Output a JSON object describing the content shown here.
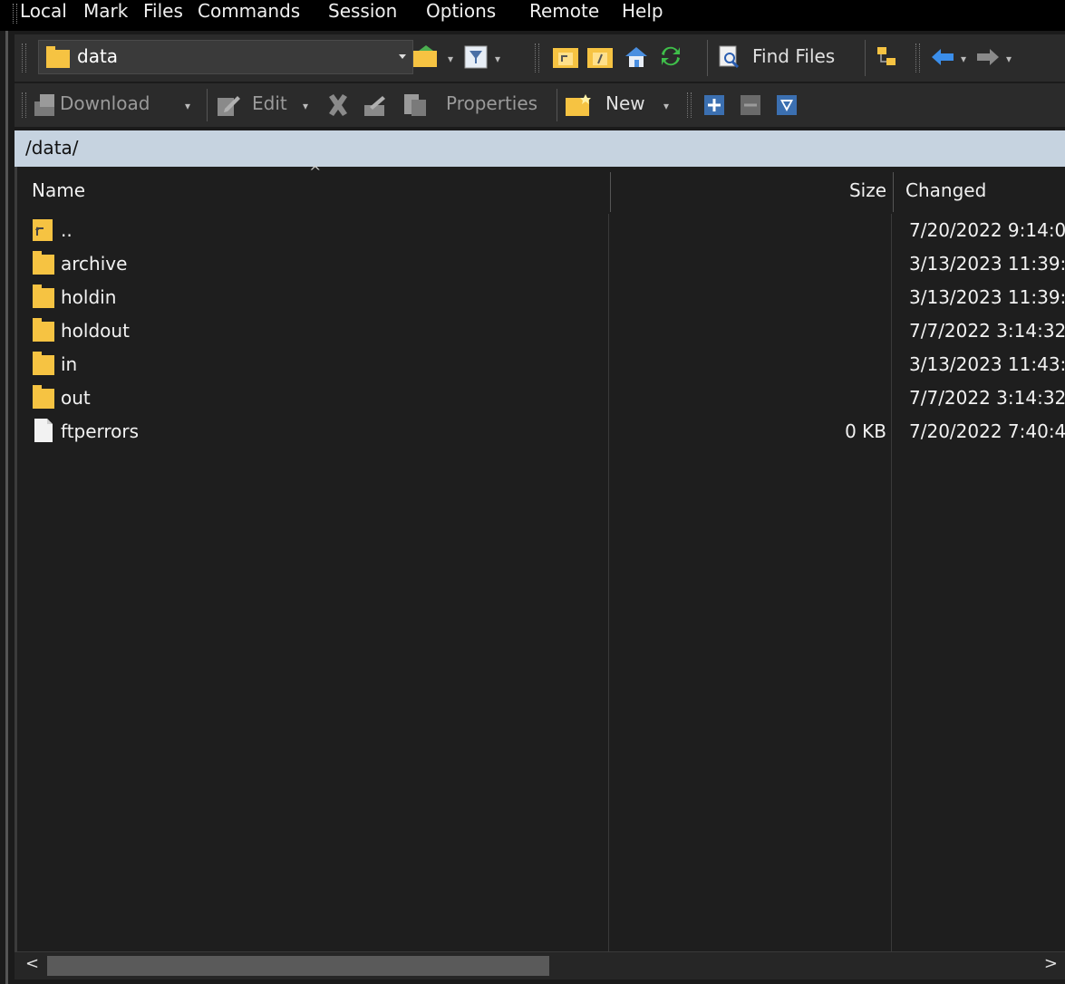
{
  "menu": [
    "Local",
    "Mark",
    "Files",
    "Commands",
    "Session",
    "Options",
    "Remote",
    "Help"
  ],
  "address": {
    "current": "data"
  },
  "toolbar1": {
    "find_files_label": "Find Files"
  },
  "toolbar2": {
    "download_label": "Download",
    "edit_label": "Edit",
    "properties_label": "Properties",
    "new_label": "New"
  },
  "path": "/data/",
  "columns": {
    "name": "Name",
    "size": "Size",
    "changed": "Changed"
  },
  "files": [
    {
      "name": "..",
      "size": "",
      "changed": "7/20/2022 9:14:0",
      "type": "parent"
    },
    {
      "name": "archive",
      "size": "",
      "changed": "3/13/2023 11:39:",
      "type": "folder"
    },
    {
      "name": "holdin",
      "size": "",
      "changed": "3/13/2023 11:39:",
      "type": "folder"
    },
    {
      "name": "holdout",
      "size": "",
      "changed": "7/7/2022 3:14:32",
      "type": "folder"
    },
    {
      "name": "in",
      "size": "",
      "changed": "3/13/2023 11:43:",
      "type": "folder"
    },
    {
      "name": "out",
      "size": "",
      "changed": "7/7/2022 3:14:32",
      "type": "folder"
    },
    {
      "name": "ftperrors",
      "size": "0 KB",
      "changed": "7/20/2022 7:40:4",
      "type": "file"
    }
  ],
  "colors": {
    "folder": "#f6c342",
    "path_bar": "#c6d3e0",
    "accent_arrow": "#3b8eea"
  },
  "icons": [
    "folder-icon",
    "open-folder-icon",
    "filter-icon",
    "parent-dir-icon",
    "root-dir-icon",
    "home-icon",
    "refresh-icon",
    "find-files-icon",
    "tree-icon",
    "back-arrow-icon",
    "forward-arrow-icon",
    "download-icon",
    "edit-icon",
    "delete-icon",
    "rename-icon",
    "properties-icon",
    "new-icon",
    "select-plus-icon",
    "select-minus-icon",
    "select-filter-icon"
  ]
}
